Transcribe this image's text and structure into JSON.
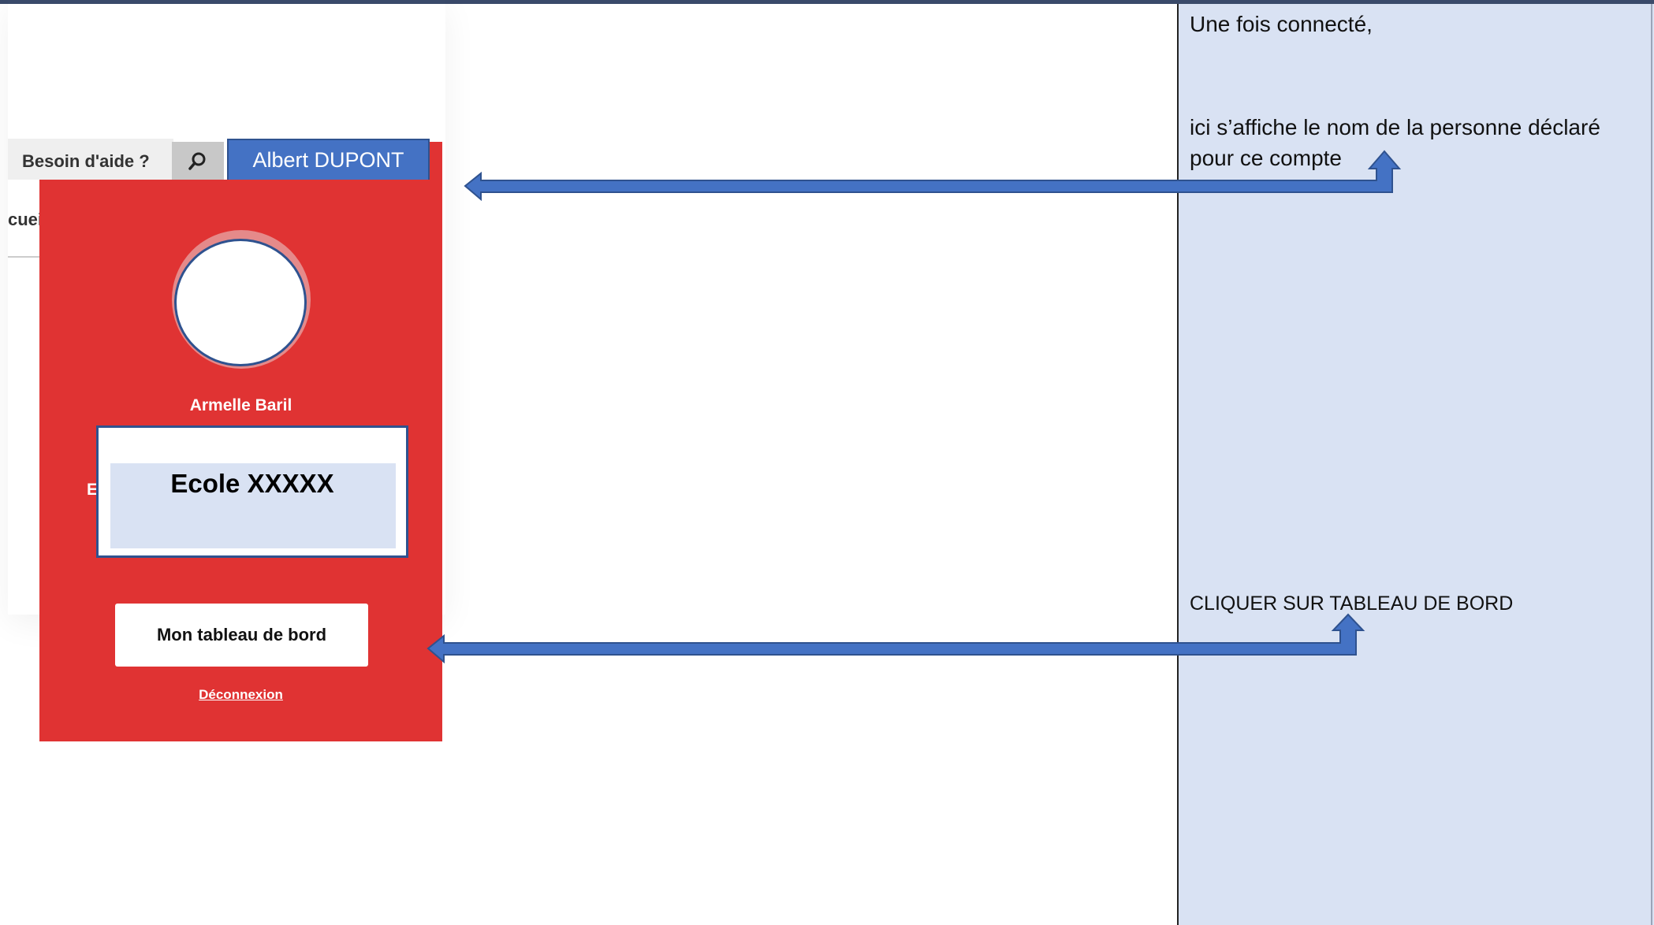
{
  "notes": {
    "line1": "Une fois connecté,",
    "line2": "ici s’affiche le nom de la personne déclaré",
    "line3": "pour ce compte",
    "line4": "CLIQUER SUR TABLEAU DE BORD"
  },
  "header": {
    "help_label": "Besoin d'aide ?",
    "user_name": "Albert DUPONT",
    "menu_fragment": "cuei"
  },
  "profile": {
    "person_name": "Armelle Baril",
    "school_name": "Ecole XXXXX",
    "school_stub": "E",
    "dashboard_label": "Mon tableau de bord",
    "logout_label": "Déconnexion"
  },
  "colors": {
    "accent_red": "#e03333",
    "accent_blue": "#4472c4",
    "note_bg": "#d9e2f3"
  }
}
